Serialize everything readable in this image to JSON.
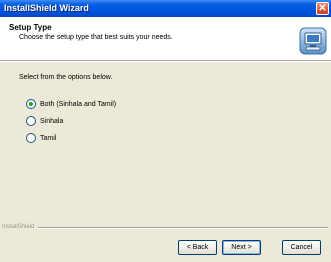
{
  "window": {
    "title": "InstallShield Wizard"
  },
  "header": {
    "title": "Setup Type",
    "subtitle": "Choose the setup type that best suits your needs."
  },
  "main": {
    "instructions": "Select from the options below.",
    "options": [
      {
        "label": "Both (Sinhala and Tamil)",
        "selected": true
      },
      {
        "label": "Sinhala",
        "selected": false
      },
      {
        "label": "Tamil",
        "selected": false
      }
    ]
  },
  "footer": {
    "brand": "InstallShield",
    "back_label": "< Back",
    "next_label": "Next >",
    "cancel_label": "Cancel"
  }
}
